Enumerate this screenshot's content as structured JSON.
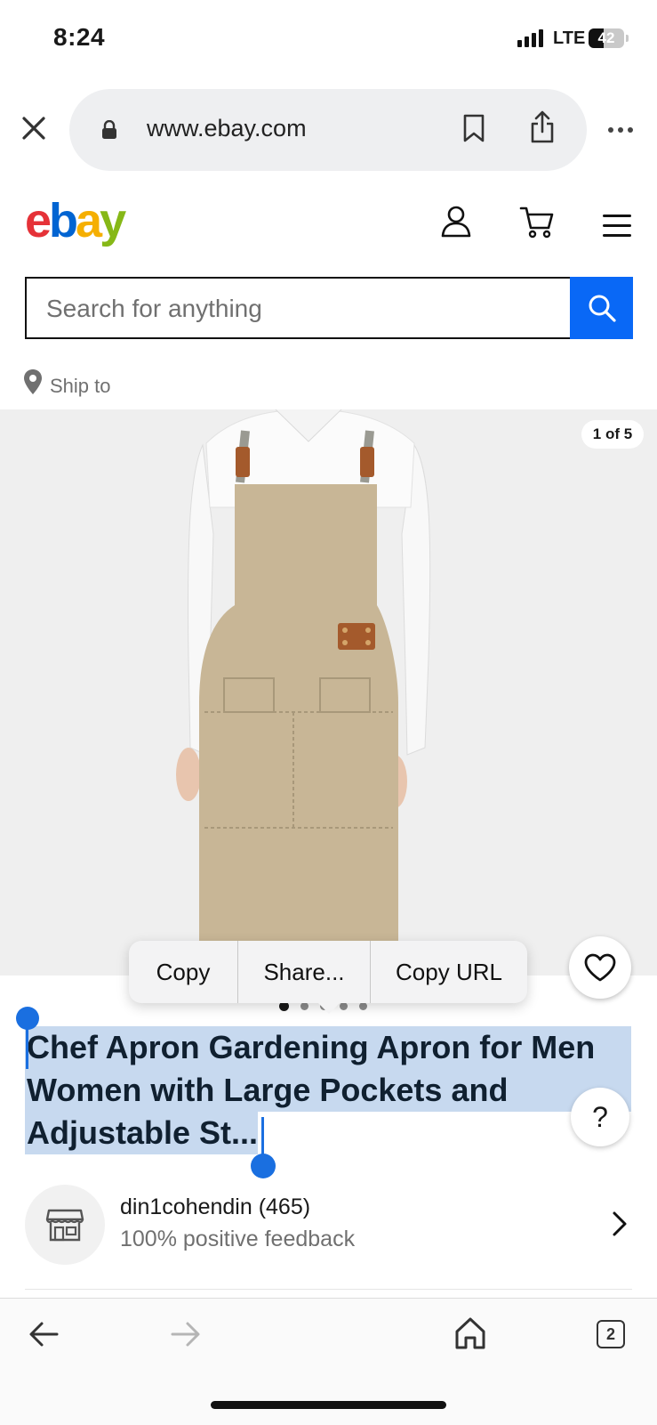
{
  "status_bar": {
    "time": "8:24",
    "network": "LTE",
    "battery": "42",
    "battery_level": 0.42
  },
  "browser": {
    "url": "www.ebay.com"
  },
  "header": {
    "logo_letters": [
      "e",
      "b",
      "a",
      "y"
    ],
    "colors": {
      "e": "#e53238",
      "b": "#0064d2",
      "a": "#f5af02",
      "y": "#86b817"
    }
  },
  "search": {
    "placeholder": "Search for anything",
    "button_color": "#0968f6"
  },
  "shipping": {
    "label": "Ship to"
  },
  "gallery": {
    "counter": "1 of 5",
    "total_images": 5,
    "current_index": 1
  },
  "context_menu": {
    "copy": "Copy",
    "share": "Share...",
    "copy_url": "Copy URL"
  },
  "product": {
    "title_lines": [
      "Chef Apron Gardening Apron for Men",
      "Women with Large Pockets and",
      "Adjustable St..."
    ],
    "selection_color": "#c7d9ef"
  },
  "help": {
    "label": "?"
  },
  "seller": {
    "name": "din1cohendin (465)",
    "feedback": "100% positive feedback"
  },
  "toolbar": {
    "tab_count": "2"
  }
}
